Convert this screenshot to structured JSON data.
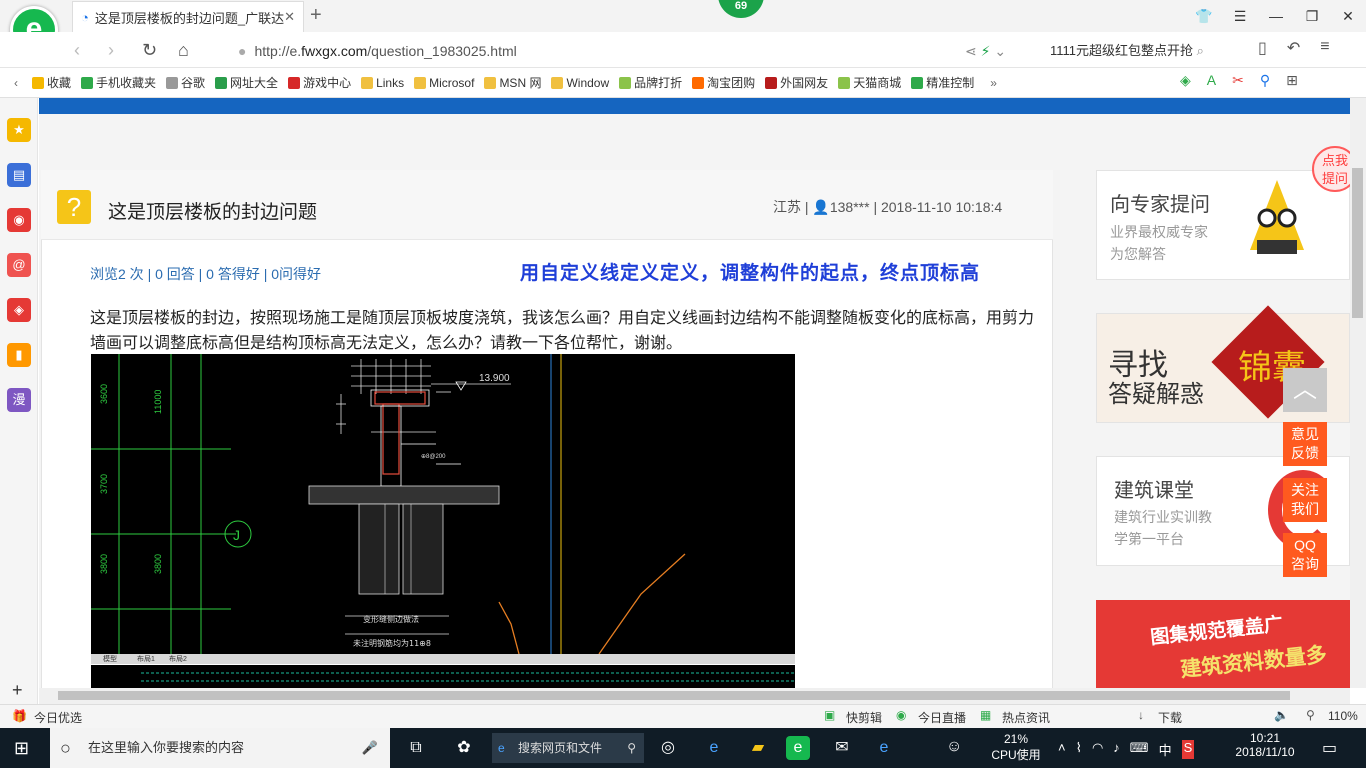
{
  "browser": {
    "tab_title": "这是顶层楼板的封边问题_广联达",
    "badge": "69",
    "url_prefix": "http://e.",
    "url_domain": "fwxgx.com",
    "url_path": "/question_1983025.html",
    "search_text": "1111元超级红包整点开抢"
  },
  "bookmarks": [
    {
      "label": "收藏",
      "color": "#f5b800"
    },
    {
      "label": "手机收藏夹",
      "color": "#2eaa4a"
    },
    {
      "label": "谷歌",
      "color": "#999999"
    },
    {
      "label": "网址大全",
      "color": "#2a9d4b"
    },
    {
      "label": "游戏中心",
      "color": "#d62828"
    },
    {
      "label": "Links",
      "color": "#f0c040"
    },
    {
      "label": "Microsof",
      "color": "#f0c040"
    },
    {
      "label": "MSN 网",
      "color": "#f0c040"
    },
    {
      "label": "Window",
      "color": "#f0c040"
    },
    {
      "label": "品牌打折",
      "color": "#8bc34a"
    },
    {
      "label": "淘宝团购",
      "color": "#ff6a00"
    },
    {
      "label": "外国网友",
      "color": "#b71c1c"
    },
    {
      "label": "天猫商城",
      "color": "#8bc34a"
    },
    {
      "label": "精准控制",
      "color": "#2eaa4a"
    }
  ],
  "sidebar_icons": [
    {
      "name": "favorites-star-icon",
      "color": "#f5b800",
      "glyph": "★"
    },
    {
      "name": "apps-icon",
      "color": "#3b6fd8",
      "glyph": "▤"
    },
    {
      "name": "weibo-icon",
      "color": "#e53935",
      "glyph": "◉"
    },
    {
      "name": "mail-icon",
      "color": "#ef5350",
      "glyph": "@"
    },
    {
      "name": "game-icon",
      "color": "#e53935",
      "glyph": "◈"
    },
    {
      "name": "reader-icon",
      "color": "#ff9800",
      "glyph": "▮"
    },
    {
      "name": "manga-icon",
      "color": "#7e57c2",
      "glyph": "漫"
    }
  ],
  "question": {
    "title": "这是顶层楼板的封边问题",
    "province": "江苏",
    "user": "138***",
    "datetime": "2018-11-10 10:18:4",
    "stats": "浏览2 次 | 0 回答 | 0 答得好 | 0问得好",
    "note": "用自定义线定义定义，调整构件的起点，终点顶标高",
    "body": "这是顶层楼板的封边，按照现场施工是随顶层顶板坡度浇筑，我该怎么画？用自定义线画封边结构不能调整随板变化的底标高，用剪力墙画可以调整底标高但是结构顶标高无法定义，怎么办？请教一下各位帮忙，谢谢。"
  },
  "cad": {
    "elevation": "13.900",
    "dims_left": [
      "3600",
      "3700",
      "3800"
    ],
    "dims_left2": [
      "11000",
      "3800"
    ],
    "grid_label": "J",
    "caption1": "变形缝侧边做法",
    "caption2": "未注明钢筋均为11⊕8",
    "tabs": [
      "模型",
      "布局1",
      "布局2"
    ]
  },
  "right": {
    "ask_title": "向专家提问",
    "ask_sub1": "业界最权威专家",
    "ask_sub2": "为您解答",
    "ask_bubble1": "点我",
    "ask_bubble2": "提问",
    "find1": "寻找",
    "find2": "答疑解惑",
    "find_red": "锦囊",
    "course_title": "建筑课堂",
    "course_sub1": "建筑行业实训教",
    "course_sub2": "学第一平台",
    "banner1": "图集规范覆盖广",
    "banner2": "建筑资料数量多"
  },
  "float_buttons": [
    "意见反馈",
    "关注我们",
    "QQ咨询"
  ],
  "status": {
    "left": "今日优选",
    "items": [
      "快剪辑",
      "今日直播",
      "热点资讯",
      "下载"
    ],
    "zoom": "110%"
  },
  "taskbar": {
    "search_placeholder": "在这里输入你要搜索的内容",
    "browser_search": "搜索网页和文件",
    "cpu_pct": "21%",
    "cpu_label": "CPU使用",
    "ime": "中",
    "time": "10:21",
    "date": "2018/11/10"
  }
}
